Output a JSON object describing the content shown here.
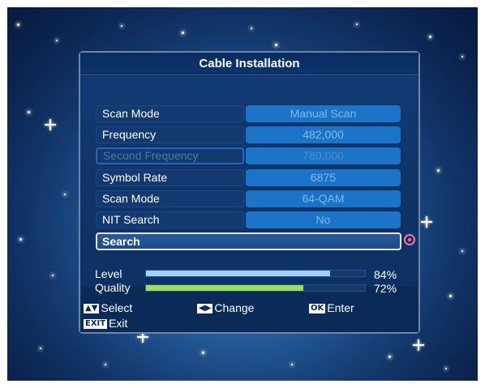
{
  "window": {
    "title": "Cable Installation"
  },
  "settings": [
    {
      "label": "Scan Mode",
      "value": "Manual Scan",
      "disabled": false
    },
    {
      "label": "Frequency",
      "value": "482,000",
      "disabled": false
    },
    {
      "label": "Second Frequency",
      "value": "780,000",
      "disabled": true
    },
    {
      "label": "Symbol Rate",
      "value": "6875",
      "disabled": false
    },
    {
      "label": "Scan Mode",
      "value": "64-QAM",
      "disabled": false
    },
    {
      "label": "NIT Search",
      "value": "No",
      "disabled": false
    }
  ],
  "search": {
    "label": "Search"
  },
  "meters": {
    "level": {
      "label": "Level",
      "percent_text": "84%",
      "fraction": 0.84,
      "color": "#9fd0ff"
    },
    "quality": {
      "label": "Quality",
      "percent_text": "72%",
      "fraction": 0.72,
      "color": "#9be05a"
    }
  },
  "hints": {
    "select": {
      "key": "▲▼",
      "label": "Select"
    },
    "change": {
      "key": "◀▶",
      "label": "Change"
    },
    "enter": {
      "key": "OK",
      "label": "Enter"
    },
    "exit": {
      "key": "EXIT",
      "label": "Exit"
    }
  },
  "colors": {
    "field_value": "#1b74c7",
    "panel": "#0b2a55",
    "focus_border": "#e9e3ee",
    "marker": "#ff6fa0"
  }
}
